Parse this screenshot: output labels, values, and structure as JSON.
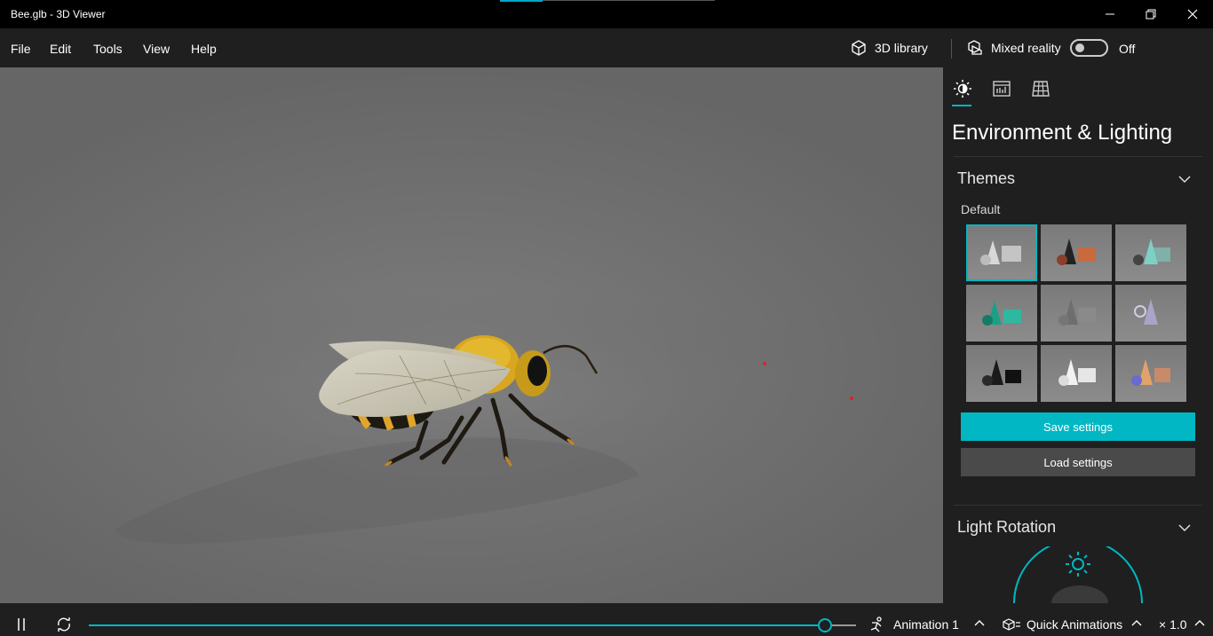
{
  "window": {
    "title": "Bee.glb - 3D Viewer"
  },
  "menu": {
    "file": "File",
    "edit": "Edit",
    "tools": "Tools",
    "view": "View",
    "help": "Help"
  },
  "toolbar": {
    "library_label": "3D library",
    "mixed_reality_label": "Mixed reality",
    "mixed_reality_state": "Off"
  },
  "panel": {
    "heading": "Environment & Lighting",
    "themes": {
      "title": "Themes",
      "group_label": "Default"
    },
    "save_label": "Save settings",
    "load_label": "Load settings",
    "light_rotation_title": "Light Rotation"
  },
  "bottom": {
    "animation_label": "Animation 1",
    "quick_label": "Quick Animations",
    "speed_label": "× 1.0",
    "progress": 0.96
  },
  "colors": {
    "accent": "#00b7c3"
  },
  "icons": {
    "panel_tabs": [
      "sun-icon",
      "stats-icon",
      "grid-icon"
    ],
    "playback": [
      "pause-icon",
      "loop-icon"
    ]
  }
}
